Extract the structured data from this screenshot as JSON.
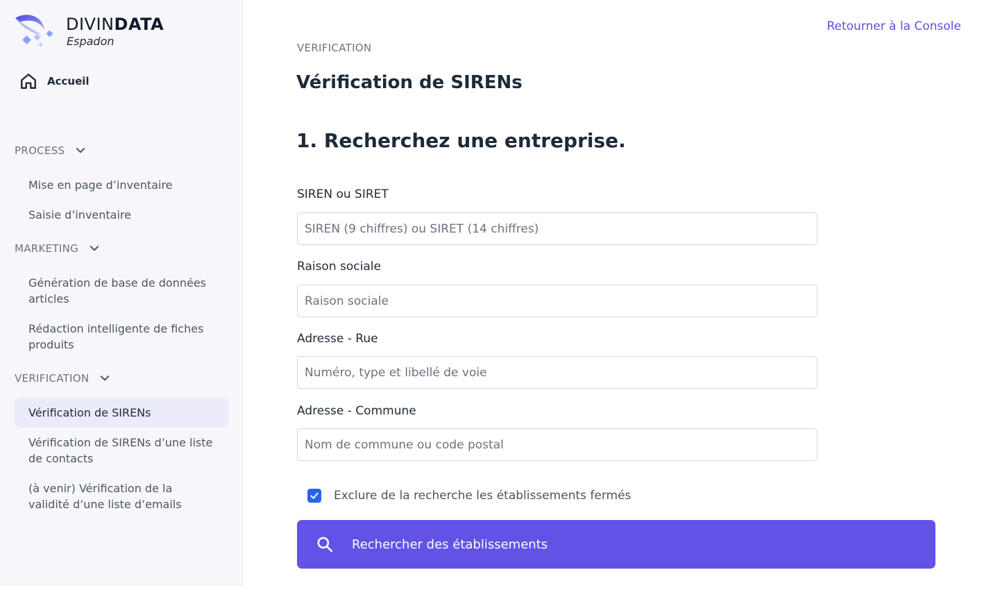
{
  "brand": {
    "name_light": "DIVIN",
    "name_bold": "DATA",
    "subtitle": "Espadon"
  },
  "sidebar": {
    "home_label": "Accueil",
    "sections": [
      {
        "label": "PROCESS",
        "items": [
          "Mise en page d’inventaire",
          "Saisie d’inventaire"
        ]
      },
      {
        "label": "MARKETING",
        "items": [
          "Génération de base de données articles",
          "Rédaction intelligente de fiches produits"
        ]
      },
      {
        "label": "VERIFICATION",
        "items": [
          "Vérification de SIRENs",
          "Vérification de SIRENs d’une liste de contacts",
          "(à venir) Vérification de la validité d’une liste d’emails"
        ]
      }
    ],
    "active_item": "Vérification de SIRENs"
  },
  "header": {
    "back_link": "Retourner à la Console"
  },
  "main": {
    "eyebrow": "VERIFICATION",
    "title": "Vérification de SIRENs",
    "step_title": "1. Recherchez une entreprise.",
    "fields": [
      {
        "label": "SIREN ou SIRET",
        "placeholder": "SIREN (9 chiffres) ou SIRET (14 chiffres)",
        "value": ""
      },
      {
        "label": "Raison sociale",
        "placeholder": "Raison sociale",
        "value": ""
      },
      {
        "label": "Adresse - Rue",
        "placeholder": "Numéro, type et libellé de voie",
        "value": ""
      },
      {
        "label": "Adresse - Commune",
        "placeholder": "Nom de commune ou code postal",
        "value": ""
      }
    ],
    "exclude_closed": {
      "label": "Exclure de la recherche les établissements fermés",
      "checked": true
    },
    "search_button": "Rechercher des établissements"
  },
  "colors": {
    "accent": "#6252e6",
    "link": "#5b50e6",
    "checkbox": "#2563eb",
    "sidebar_bg": "#f7f7fb",
    "active_bg": "#ebebf9"
  },
  "icons": {
    "logo": "swordfish-logo-icon",
    "home": "home-icon",
    "chevron": "chevron-down-icon",
    "check": "check-icon",
    "search": "search-icon"
  }
}
